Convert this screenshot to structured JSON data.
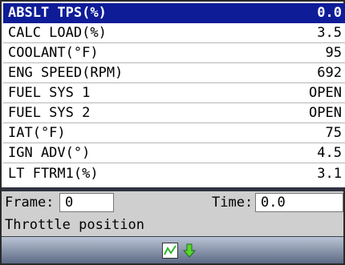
{
  "pid_list": [
    {
      "name": "ABSLT TPS(%)",
      "value": "0.0",
      "selected": true
    },
    {
      "name": "CALC LOAD(%)",
      "value": "3.5"
    },
    {
      "name": "COOLANT(°F)",
      "value": "95"
    },
    {
      "name": "ENG SPEED(RPM)",
      "value": "692"
    },
    {
      "name": "FUEL SYS 1",
      "value": "OPEN"
    },
    {
      "name": "FUEL SYS 2",
      "value": "OPEN"
    },
    {
      "name": "IAT(°F)",
      "value": "75"
    },
    {
      "name": "IGN ADV(°)",
      "value": "4.5"
    },
    {
      "name": "LT FTRM1(%)",
      "value": "3.1"
    }
  ],
  "info": {
    "frame_label": "Frame:",
    "frame_value": "0",
    "time_label": "Time:",
    "time_value": "0.0",
    "description": "Throttle position"
  },
  "toolbar": {
    "buttons": [
      "graph-icon",
      "down-arrow-icon"
    ]
  },
  "colors": {
    "selection": "#0f1c98",
    "panel": "#cfcfcf",
    "graph_line": "#2db52d",
    "arrow": "#5ad52a"
  }
}
